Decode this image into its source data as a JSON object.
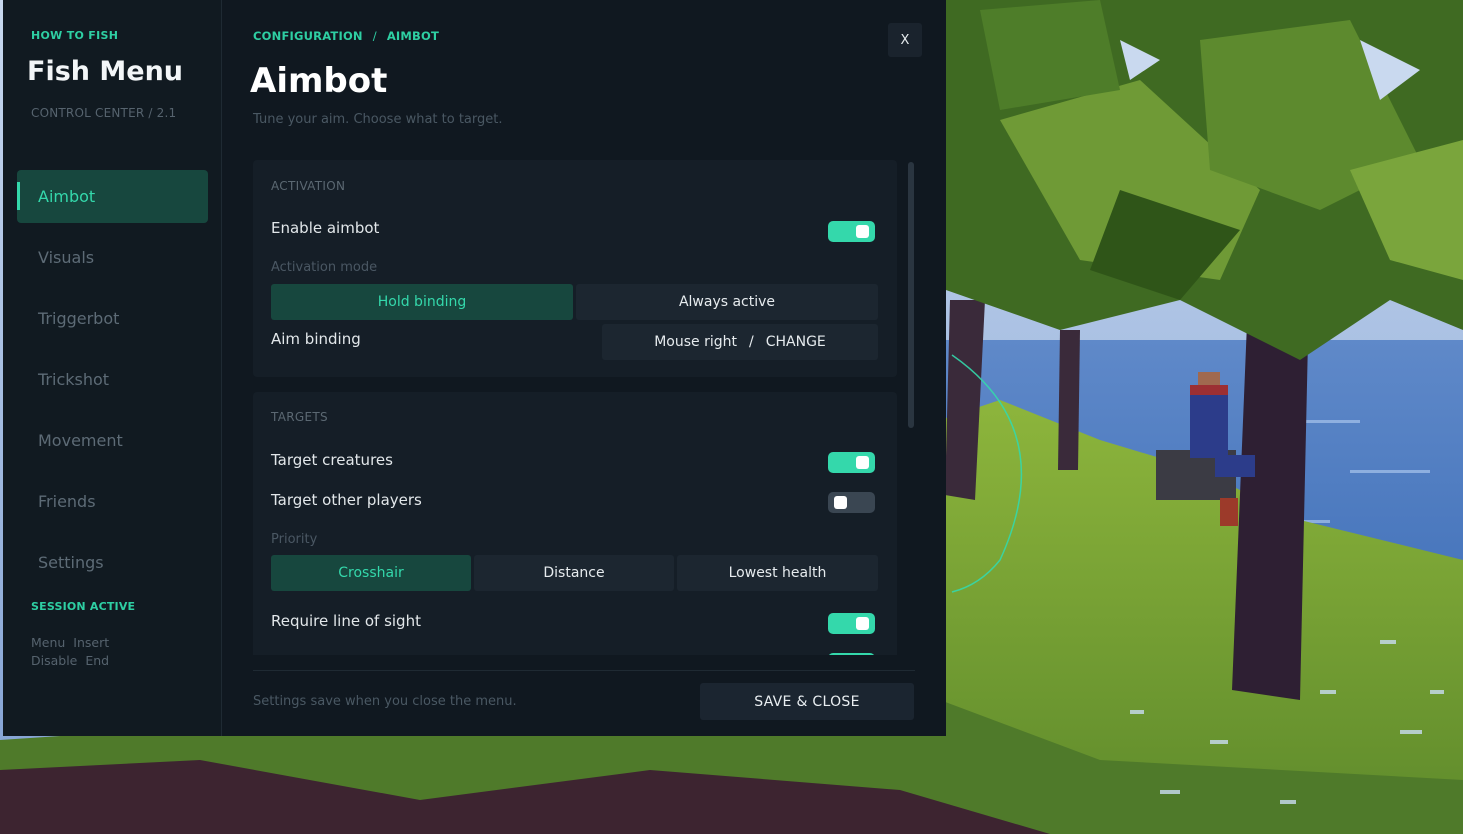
{
  "sidebar": {
    "kicker": "HOW TO FISH",
    "title": "Fish Menu",
    "subtitle": "CONTROL CENTER  /  2.1",
    "items": [
      {
        "label": "Aimbot"
      },
      {
        "label": "Visuals"
      },
      {
        "label": "Triggerbot"
      },
      {
        "label": "Trickshot"
      },
      {
        "label": "Movement"
      },
      {
        "label": "Friends"
      },
      {
        "label": "Settings"
      }
    ],
    "session": "SESSION ACTIVE",
    "keys": [
      {
        "action": "Menu",
        "key": "Insert"
      },
      {
        "action": "Disable",
        "key": "End"
      }
    ]
  },
  "header": {
    "breadcrumb": [
      "CONFIGURATION",
      "AIMBOT"
    ],
    "breadcrumb_sep": "/",
    "close_label": "X",
    "title": "Aimbot",
    "subtitle": "Tune your aim. Choose what to target."
  },
  "activation": {
    "section_label": "ACTIVATION",
    "enable_label": "Enable aimbot",
    "enable_on": true,
    "mode_label": "Activation mode",
    "modes": [
      "Hold binding",
      "Always active"
    ],
    "selected_mode": "Hold binding",
    "binding_label": "Aim binding",
    "binding_value": "Mouse right",
    "binding_sep": "/",
    "binding_action": "CHANGE"
  },
  "targets": {
    "section_label": "TARGETS",
    "creatures_label": "Target creatures",
    "creatures_on": true,
    "players_label": "Target other players",
    "players_on": false,
    "priority_label": "Priority",
    "priorities": [
      "Crosshair",
      "Distance",
      "Lowest health"
    ],
    "selected_priority": "Crosshair",
    "los_label": "Require line of sight",
    "los_on": true
  },
  "footer": {
    "note": "Settings save when you close the menu.",
    "save_label": "SAVE & CLOSE"
  },
  "colors": {
    "accent": "#34d8ab",
    "panel": "#101820",
    "card": "#151e27",
    "selected_bg": "#17473e"
  }
}
